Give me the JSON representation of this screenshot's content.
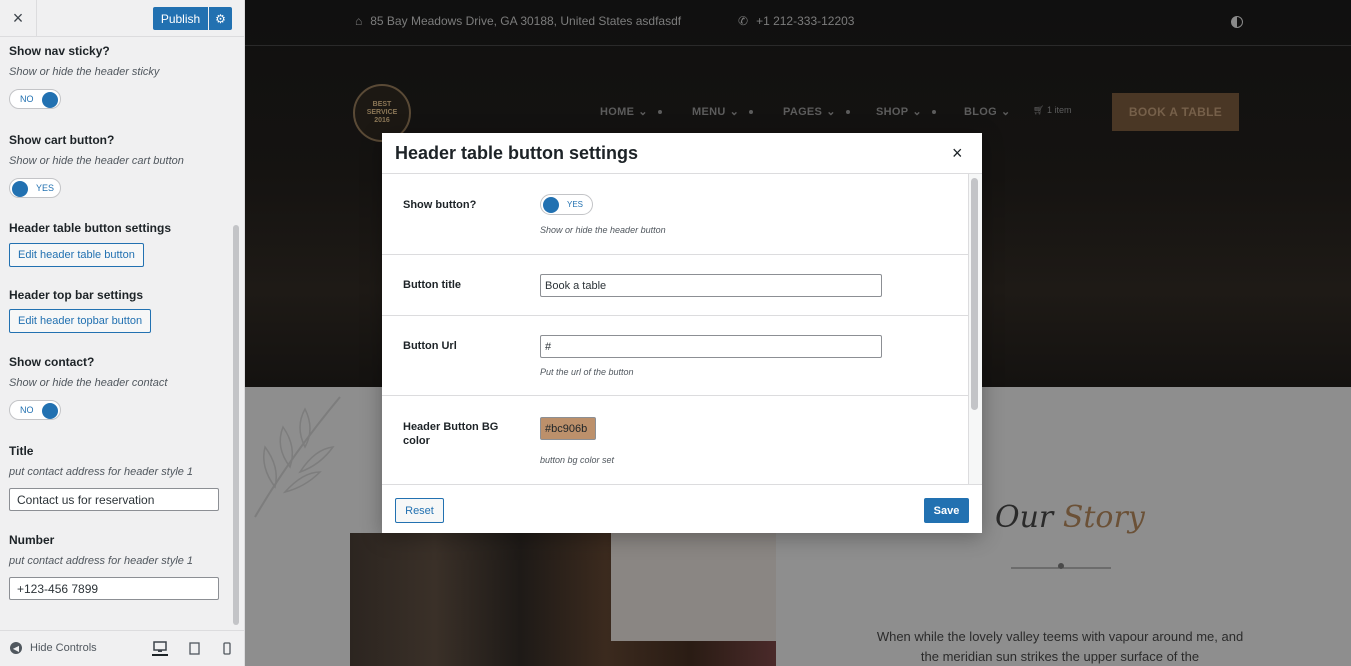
{
  "sidebar": {
    "close_glyph": "×",
    "publish_label": "Publish",
    "controls": {
      "nav_sticky": {
        "title": "Show nav sticky?",
        "desc": "Show or hide the header sticky",
        "state": "NO"
      },
      "cart_button": {
        "title": "Show cart button?",
        "desc": "Show or hide the header cart button",
        "state": "YES"
      },
      "table_button": {
        "title": "Header table button settings",
        "button_label": "Edit header table button"
      },
      "top_bar": {
        "title": "Header top bar settings",
        "button_label": "Edit header topbar button"
      },
      "contact": {
        "title": "Show contact?",
        "desc": "Show or hide the header contact",
        "state": "NO"
      },
      "contact_title": {
        "title": "Title",
        "desc": "put contact address for header style 1",
        "value": "Contact us for reservation"
      },
      "contact_number": {
        "title": "Number",
        "desc": "put contact address for header style 1",
        "value": "+123-456 7899"
      }
    },
    "footer": {
      "hide_controls_label": "Hide Controls"
    }
  },
  "preview": {
    "topbar": {
      "address": "85 Bay Meadows Drive, GA 30188, United States asdfasdf",
      "phone": "+1 212-333-12203"
    },
    "logo": {
      "line1": "BEST",
      "line2": "SERVICE",
      "line3": "2016"
    },
    "nav": [
      {
        "label": "HOME"
      },
      {
        "label": "MENU"
      },
      {
        "label": "PAGES"
      },
      {
        "label": "SHOP"
      },
      {
        "label": "BLOG"
      }
    ],
    "cart_label": "1 item",
    "book_button": "BOOK A TABLE",
    "story": {
      "title_a": "Our",
      "title_b": "Story",
      "text": "When while the lovely valley teems with vapour around me, and the meridian sun strikes the upper surface of the"
    }
  },
  "modal": {
    "title": "Header table button settings",
    "close_glyph": "×",
    "fields": {
      "show_button": {
        "label": "Show button?",
        "state": "YES",
        "desc": "Show or hide the header button"
      },
      "button_title": {
        "label": "Button title",
        "value": "Book a table"
      },
      "button_url": {
        "label": "Button Url",
        "value": "#",
        "desc": "Put the url of the button"
      },
      "bg_color": {
        "label": "Header Button BG color",
        "value": "#bc906b",
        "desc": "button bg color set"
      }
    },
    "reset_label": "Reset",
    "save_label": "Save"
  },
  "colors": {
    "accent": "#2271b1",
    "button_bg": "#bc906b"
  }
}
